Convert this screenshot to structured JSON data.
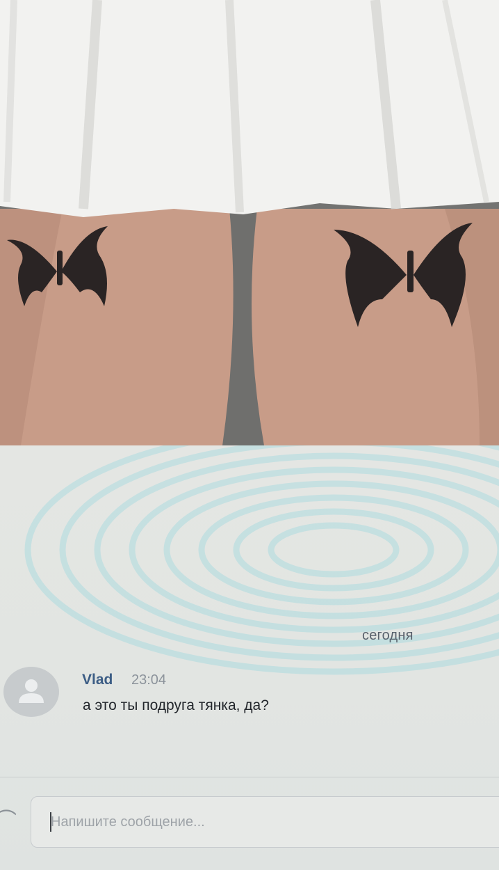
{
  "chat": {
    "date_separator": "сегодня",
    "message": {
      "author": "Vlad",
      "time": "23:04",
      "text": "а это ты подруга тянка, да?"
    },
    "composer": {
      "placeholder": "Напишите сообщение..."
    }
  },
  "colors": {
    "author_link": "#3c5d85",
    "background": "#e2e5e2",
    "moire_tint": "#7fd3de"
  },
  "icons": [
    "avatar-placeholder-icon",
    "attach-icon"
  ]
}
